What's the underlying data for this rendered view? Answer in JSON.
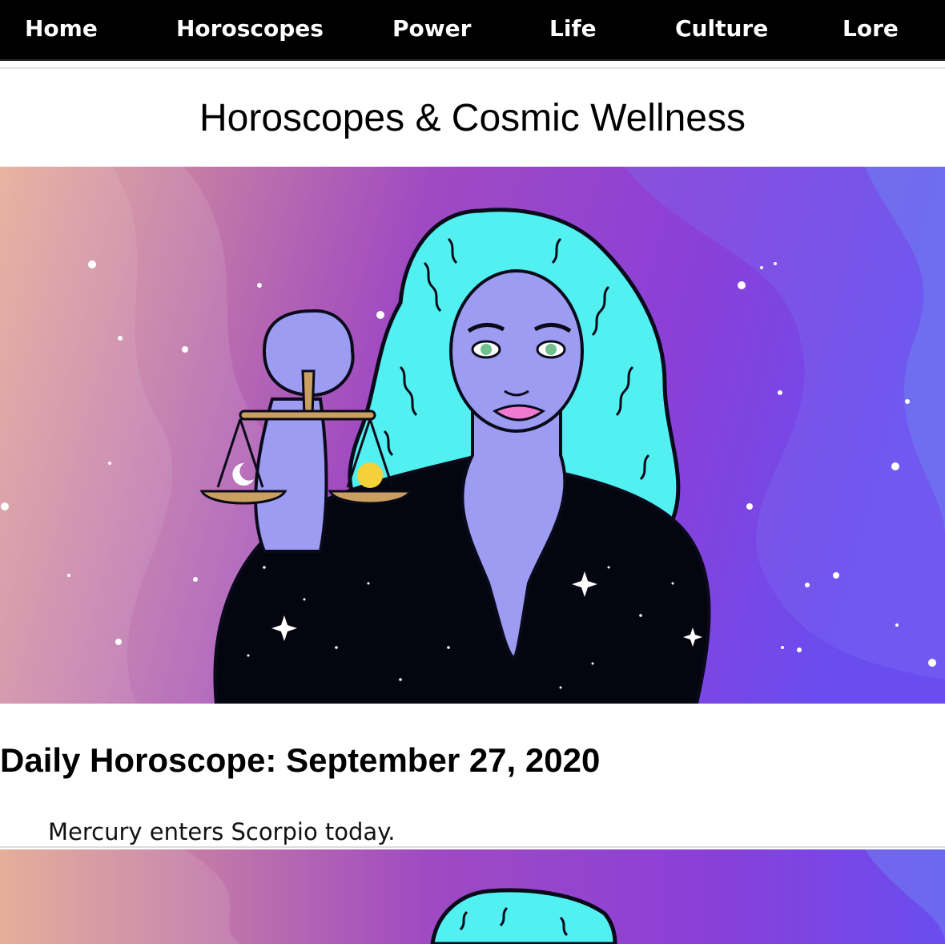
{
  "nav": {
    "items": [
      {
        "label": "Home"
      },
      {
        "label": "Horoscopes"
      },
      {
        "label": "Power"
      },
      {
        "label": "Life"
      },
      {
        "label": "Culture"
      },
      {
        "label": "Lore"
      }
    ]
  },
  "page": {
    "title": "Horoscopes & Cosmic Wellness"
  },
  "articles": [
    {
      "title": "Daily Horoscope: September 27, 2020",
      "blurb": "Mercury enters Scorpio today.",
      "image_subject": "libra-woman-holding-scales-illustration"
    },
    {
      "image_subject": "libra-woman-holding-scales-illustration"
    }
  ],
  "colors": {
    "nav_background": "#000000",
    "nav_text": "#ffffff",
    "hero_gradient_start": "#e2a48f",
    "hero_gradient_mid": "#9a45c9",
    "hero_gradient_end": "#6a30e6",
    "hair": "#55f0ef",
    "skin": "#9c9cf2"
  }
}
